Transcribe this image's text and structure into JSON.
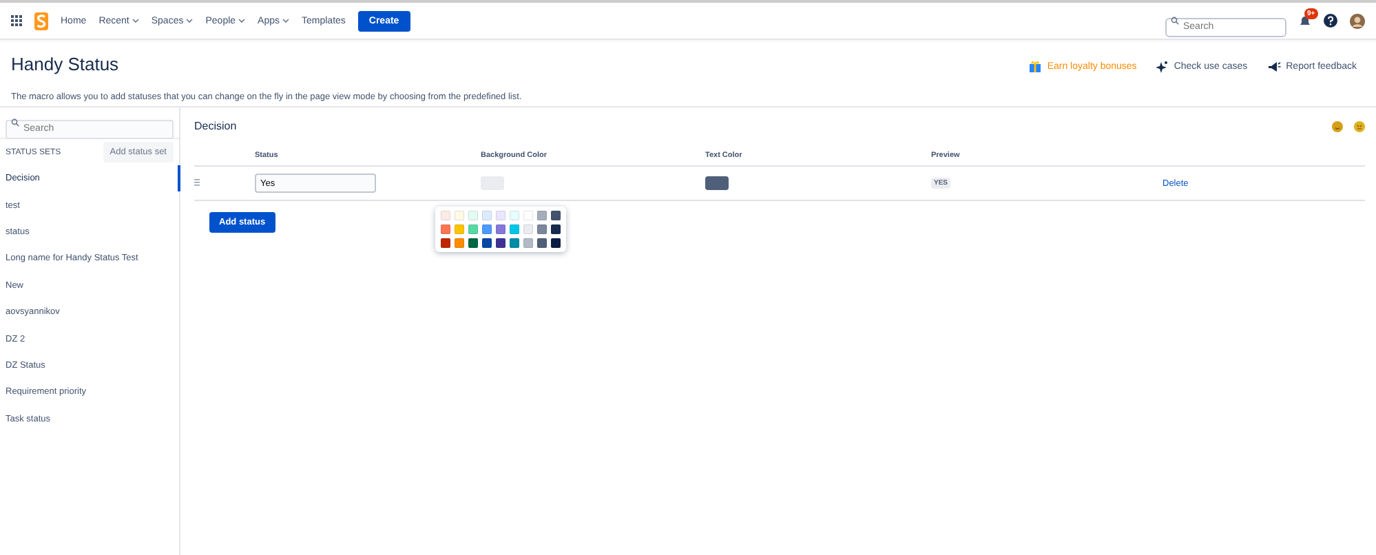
{
  "nav": {
    "items": [
      {
        "label": "Home",
        "dropdown": false
      },
      {
        "label": "Recent",
        "dropdown": true
      },
      {
        "label": "Spaces",
        "dropdown": true
      },
      {
        "label": "People",
        "dropdown": true
      },
      {
        "label": "Apps",
        "dropdown": true
      },
      {
        "label": "Templates",
        "dropdown": false
      }
    ],
    "create": "Create",
    "search": {
      "placeholder": "Search"
    },
    "notifications": "9+"
  },
  "header": {
    "title": "Handy Status",
    "description": "The macro allows you to add statuses that you can change on the fly in the page view mode by choosing from the predefined list.",
    "actions": [
      {
        "kind": "gift",
        "label": "Earn loyalty bonuses"
      },
      {
        "kind": "sparkle",
        "label": "Check use cases"
      },
      {
        "kind": "megaphone",
        "label": "Report feedback"
      }
    ]
  },
  "sidebar": {
    "search": {
      "placeholder": "Search"
    },
    "heading": "STATUS SETS",
    "add_button": "Add status set",
    "items": [
      {
        "label": "Decision",
        "selected": true
      },
      {
        "label": "test",
        "selected": false
      },
      {
        "label": "status",
        "selected": false
      },
      {
        "label": "Long name for Handy Status Test",
        "selected": false
      },
      {
        "label": "New",
        "selected": false
      },
      {
        "label": "aovsyannikov",
        "selected": false
      },
      {
        "label": "DZ 2",
        "selected": false
      },
      {
        "label": "DZ Status",
        "selected": false
      },
      {
        "label": "Requirement priority",
        "selected": false
      },
      {
        "label": "Task status",
        "selected": false
      }
    ]
  },
  "editor": {
    "title": "Decision",
    "columns": [
      "Status",
      "Background Color",
      "Text Color",
      "Preview"
    ],
    "rows": [
      {
        "status": "Yes",
        "background": {
          "color": "#ebecf0"
        },
        "text": {
          "color": "#505f79"
        },
        "preview": "YES",
        "delete": "Delete"
      }
    ],
    "add_button": "Add status",
    "palette": [
      {
        "color": "#ffebe6"
      },
      {
        "color": "#fffae6"
      },
      {
        "color": "#e3fcef"
      },
      {
        "color": "#deebff"
      },
      {
        "color": "#eae6ff"
      },
      {
        "color": "#e6fcff"
      },
      {
        "color": "#ffffff"
      },
      {
        "color": "#a5adba"
      },
      {
        "color": "#42526e"
      },
      {
        "color": "#ff7452"
      },
      {
        "color": "#ffc400"
      },
      {
        "color": "#57d9a3"
      },
      {
        "color": "#4c9aff"
      },
      {
        "color": "#8777d9"
      },
      {
        "color": "#00c7e6"
      },
      {
        "color": "#ebecf0"
      },
      {
        "color": "#7a869a"
      },
      {
        "color": "#172b4d"
      },
      {
        "color": "#bf2600"
      },
      {
        "color": "#ff8b00"
      },
      {
        "color": "#006644"
      },
      {
        "color": "#0747a6"
      },
      {
        "color": "#403294"
      },
      {
        "color": "#008da6"
      },
      {
        "color": "#b3bac5"
      },
      {
        "color": "#505f79"
      },
      {
        "color": "#091e42"
      }
    ]
  }
}
